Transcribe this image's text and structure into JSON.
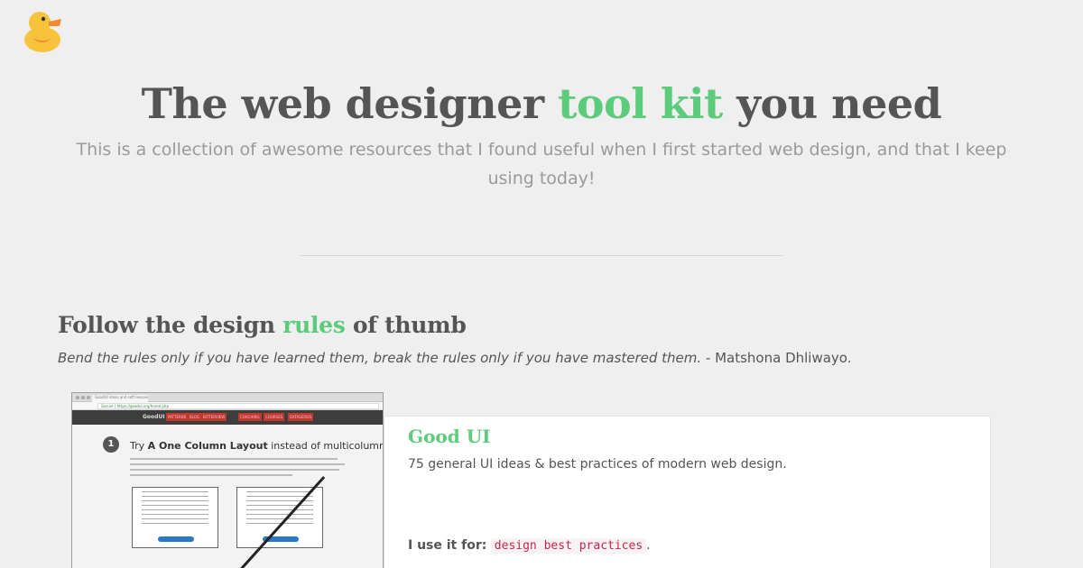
{
  "logo": {
    "icon": "rubber-duck-icon"
  },
  "hero": {
    "title_before": "The web designer ",
    "title_accent": "tool kit",
    "title_after": " you need",
    "subtitle": "This is a collection of awesome resources that I found useful when I first started web design, and that I keep using today!"
  },
  "section": {
    "title_before": "Follow the design ",
    "title_accent": "rules",
    "title_after": " of thumb",
    "quote_text": "Bend the rules only if you have learned them, break the rules only if you have mastered them.",
    "quote_author": " - Matshona Dhliwayo."
  },
  "resource": {
    "title": "Good UI",
    "description": "75 general UI ideas & best practices of modern web design.",
    "use_label": "I use it for:",
    "tag": "design best practices",
    "tag_suffix": "."
  },
  "thumbnail": {
    "tab_title": "GoodUI ideas and soft lessons",
    "url": "Secure | https://goodui.org/home.php",
    "brand": "GoodUI",
    "nav_items": [
      "PATTERNS",
      "BLOG",
      "BITTERVIEW",
      "COACHING",
      "COURSES",
      "DATASERIES"
    ],
    "badge": "1",
    "heading_before": "Try ",
    "heading_bold": "A One Column Layout",
    "heading_after": " instead of multicolumns."
  },
  "colors": {
    "accent": "#5ccc7c",
    "text": "#555555",
    "muted": "#9a9a9a",
    "background": "#efefef",
    "tag": "#c7254e"
  }
}
